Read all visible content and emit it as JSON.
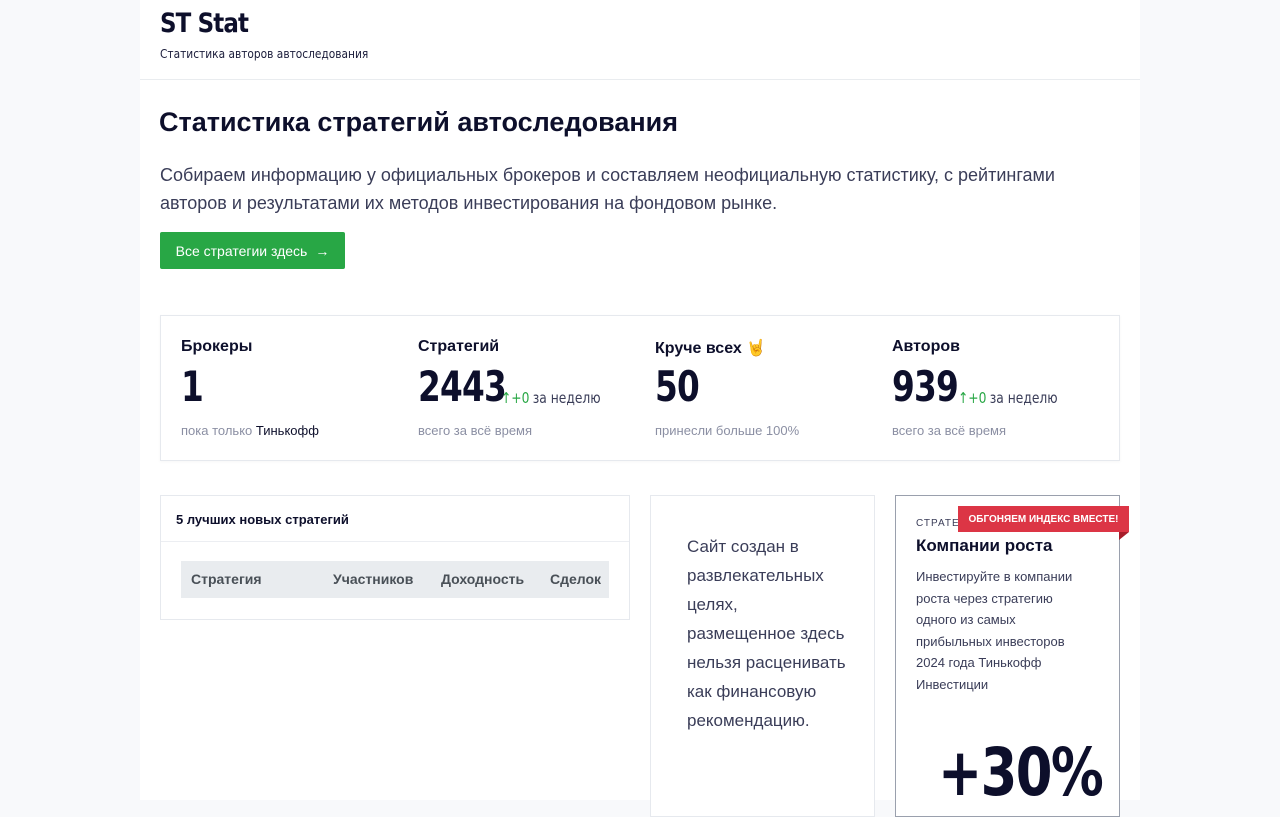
{
  "header": {
    "brand": "ST Stat",
    "subtitle": "Статистика авторов автоследования"
  },
  "hero": {
    "title": "Статистика стратегий автоследования",
    "text": "Собираем информацию у официальных брокеров и составляем неофициальную статистику, с рейтингами авторов и результатами их методов инвестирования на фондовом рынке.",
    "cta_label": "Все стратегии здесь",
    "cta_icon": "arrow-right-icon"
  },
  "stats": [
    {
      "label": "Брокеры",
      "value": "1",
      "note_prefix": "пока только ",
      "note_strong": "Тинькофф"
    },
    {
      "label": "Стратегий",
      "value": "2443",
      "delta": "↑+0",
      "delta_text": "за неделю",
      "note": "всего за всё время"
    },
    {
      "label": "Круче всех 🤘",
      "value": "50",
      "note": "принесли больше 100%"
    },
    {
      "label": "Авторов",
      "value": "939",
      "delta": "↑+0",
      "delta_text": "за неделю",
      "note": "всего за всё время"
    }
  ],
  "top5": {
    "title": "5 лучших новых стратегий",
    "columns": [
      "Стратегия",
      "Участников",
      "Доходность",
      "Сделок"
    ]
  },
  "disclaimer": {
    "text": "Сайт создан в развлекательных целях, размещенное здесь нельзя расценивать как финансовую рекомендацию."
  },
  "promo": {
    "kicker": "СТРАТЕГ",
    "ribbon": "ОБГОНЯЕМ ИНДЕКС ВМЕСТЕ!",
    "title": "Компании роста",
    "text": "Инвестируйте в компании роста через стратегию одного из самых прибыльных инвесторов 2024 года Тинькофф Инвестиции",
    "big": "+30%"
  },
  "colors": {
    "accent_green": "#28a745",
    "ribbon_red": "#dc3545",
    "text_dark": "#0d0f2b"
  }
}
